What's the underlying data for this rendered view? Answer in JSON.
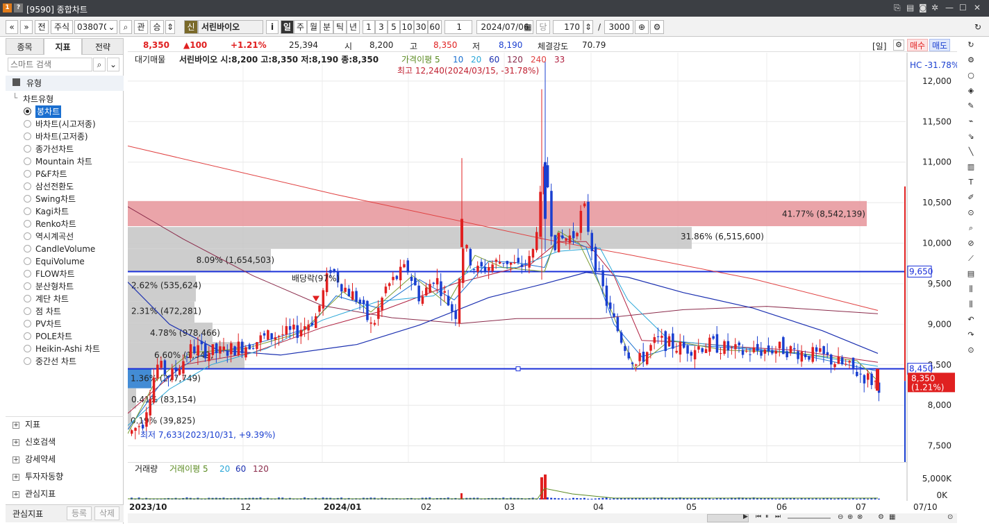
{
  "window": {
    "title": "[9590] 종합차트",
    "badge1": "1",
    "badge2": "?"
  },
  "toolbar": {
    "prev": "«",
    "menu": "»",
    "full": "전",
    "asset_type": "주식",
    "code": "038070",
    "gwan": "관",
    "sang": "승",
    "sin": "신",
    "name": "서린바이오",
    "info": "i",
    "periods": [
      "일",
      "주",
      "월",
      "분",
      "틱",
      "년"
    ],
    "mins": [
      "1",
      "3",
      "5",
      "10",
      "30",
      "60"
    ],
    "unit_value": "1",
    "date": "2024/07/06",
    "dang": "당",
    "count": "170",
    "slash": "/",
    "max": "3000"
  },
  "left_panel": {
    "tabs": [
      "종목",
      "지표",
      "전략"
    ],
    "search_placeholder": "스마트 검색",
    "section_type": "유형",
    "chart_types_title": "차트유형",
    "items": [
      "봉차트",
      "바차트(시고저종)",
      "바차트(고저종)",
      "종가선차트",
      "Mountain 차트",
      "P&F차트",
      "삼선전환도",
      "Swing차트",
      "Kagi차트",
      "Renko차트",
      "역시계곡선",
      "CandleVolume",
      "EquiVolume",
      "FLOW차트",
      "분산형차트",
      "계단 차트",
      "점 차트",
      "PV차트",
      "POLE차트",
      "Heikin-Ashi 차트",
      "중간선 차트"
    ],
    "sections": [
      "지표",
      "신호검색",
      "강세약세",
      "투자자동향",
      "관심지표"
    ],
    "fav_label": "관심지표",
    "register": "등록",
    "delete": "삭제"
  },
  "infobar": {
    "price": "8,350",
    "change": "▲100",
    "change_pct": "+1.21%",
    "volume": "25,394",
    "open_label": "시",
    "open": "8,200",
    "high_label": "고",
    "high": "8,350",
    "low_label": "저",
    "low": "8,190",
    "strength_label": "체결강도",
    "strength": "70.79",
    "period_tag": "[일]",
    "buy": "매수",
    "sell": "매도"
  },
  "legend": {
    "main": "대기매물",
    "ohlc": "서린바이오 시:8,200 고:8,350 저:8,190 종:8,350",
    "ma_label": "가격이평 5",
    "ma": [
      "10",
      "20",
      "60",
      "120",
      "240",
      "33"
    ],
    "hc": "HC -31.78%"
  },
  "annotations": {
    "high": "최고 12,240(2024/03/15, -31.78%)",
    "low": "최저 7,633(2023/10/31, +9.39%)",
    "dividend": "배당락(97%)",
    "line_9650": "9,650",
    "line_8450": "8,450",
    "cur_price": "8,350",
    "cur_pct": "(1.21%)"
  },
  "volume_profile": [
    {
      "label": "41.77% (8,542,139)"
    },
    {
      "label": "31.86% (6,515,600)"
    },
    {
      "label": "8.09% (1,654,503)"
    },
    {
      "label": "2.62% (535,624)"
    },
    {
      "label": "2.31% (472,281)"
    },
    {
      "label": "4.78% (978,466)"
    },
    {
      "label": "6.60% (1,349,"
    },
    {
      "label": "1.36% (277,749)"
    },
    {
      "label": "0.41% (83,154)"
    },
    {
      "label": "0.19% (39,825)"
    }
  ],
  "volume_legend": {
    "main": "거래량",
    "ma5": "거래이평 5",
    "ma20": "20",
    "ma60": "60",
    "ma120": "120"
  },
  "volume_axis": [
    "5,000K",
    "0K"
  ],
  "chart_data": {
    "type": "candlestick",
    "ylabels": [
      "12,000",
      "11,500",
      "11,000",
      "10,500",
      "10,000",
      "9,500",
      "9,000",
      "8,500",
      "8,000",
      "7,500"
    ],
    "ylim": [
      7300,
      12350
    ],
    "xlabels": [
      "2023/10",
      "12",
      "2024/01",
      "02",
      "03",
      "04",
      "05",
      "06",
      "07",
      "07/10"
    ]
  },
  "colors": {
    "up": "#e02020",
    "down": "#1a3fd0",
    "hline": "#1a2fd8",
    "vp_top": "#e89aa0",
    "vp": "#c8c8c8",
    "vp_blue": "#2f7fd0"
  }
}
